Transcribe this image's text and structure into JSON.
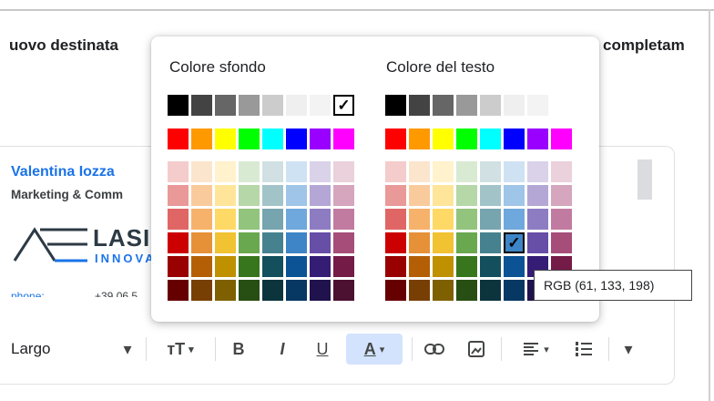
{
  "header": {
    "left_text": "uovo destinata",
    "right_text": "completam"
  },
  "signature": {
    "name": "Valentina Iozza",
    "role": "Marketing & Comm",
    "logo_text": "LASI",
    "logo_sub": "INNOVA",
    "cut_label": "phone:",
    "cut_value": "+39 06 5"
  },
  "toolbar": {
    "font_label": "Largo",
    "caret": "▾",
    "bold": "B",
    "italic": "I",
    "underline": "U",
    "text_color": "A",
    "font_size_icon": "тT"
  },
  "color_popup": {
    "background_title": "Colore sfondo",
    "text_title": "Colore del testo",
    "checkmark": "✓",
    "grays": [
      "#000000",
      "#434343",
      "#666666",
      "#999999",
      "#cccccc",
      "#efefef",
      "#f3f3f3",
      "#ffffff"
    ],
    "brights": [
      "#ff0000",
      "#ff9900",
      "#ffff00",
      "#00ff00",
      "#00ffff",
      "#0000ff",
      "#9900ff",
      "#ff00ff"
    ],
    "shades": [
      [
        "#f4cccc",
        "#fce5cd",
        "#fff2cc",
        "#d9ead3",
        "#d0e0e3",
        "#cfe2f3",
        "#d9d2e9",
        "#ead1dc"
      ],
      [
        "#ea9999",
        "#f9cb9c",
        "#ffe599",
        "#b6d7a8",
        "#a2c4c9",
        "#9fc5e8",
        "#b4a7d6",
        "#d5a6bd"
      ],
      [
        "#e06666",
        "#f6b26b",
        "#ffd966",
        "#93c47d",
        "#76a5af",
        "#6fa8dc",
        "#8e7cc3",
        "#c27ba0"
      ],
      [
        "#cc0000",
        "#e69138",
        "#f1c232",
        "#6aa84f",
        "#45818e",
        "#3d85c6",
        "#674ea7",
        "#a64d79"
      ],
      [
        "#990000",
        "#b45f06",
        "#bf9000",
        "#38761d",
        "#134f5c",
        "#0b5394",
        "#351c75",
        "#741b47"
      ],
      [
        "#660000",
        "#783f04",
        "#7f6000",
        "#274e13",
        "#0c343d",
        "#073763",
        "#20124d",
        "#4c1130"
      ]
    ],
    "bg_selected": "#ffffff",
    "text_selected": "#3d85c6"
  },
  "tooltip": {
    "text": "RGB (61, 133, 198)"
  }
}
